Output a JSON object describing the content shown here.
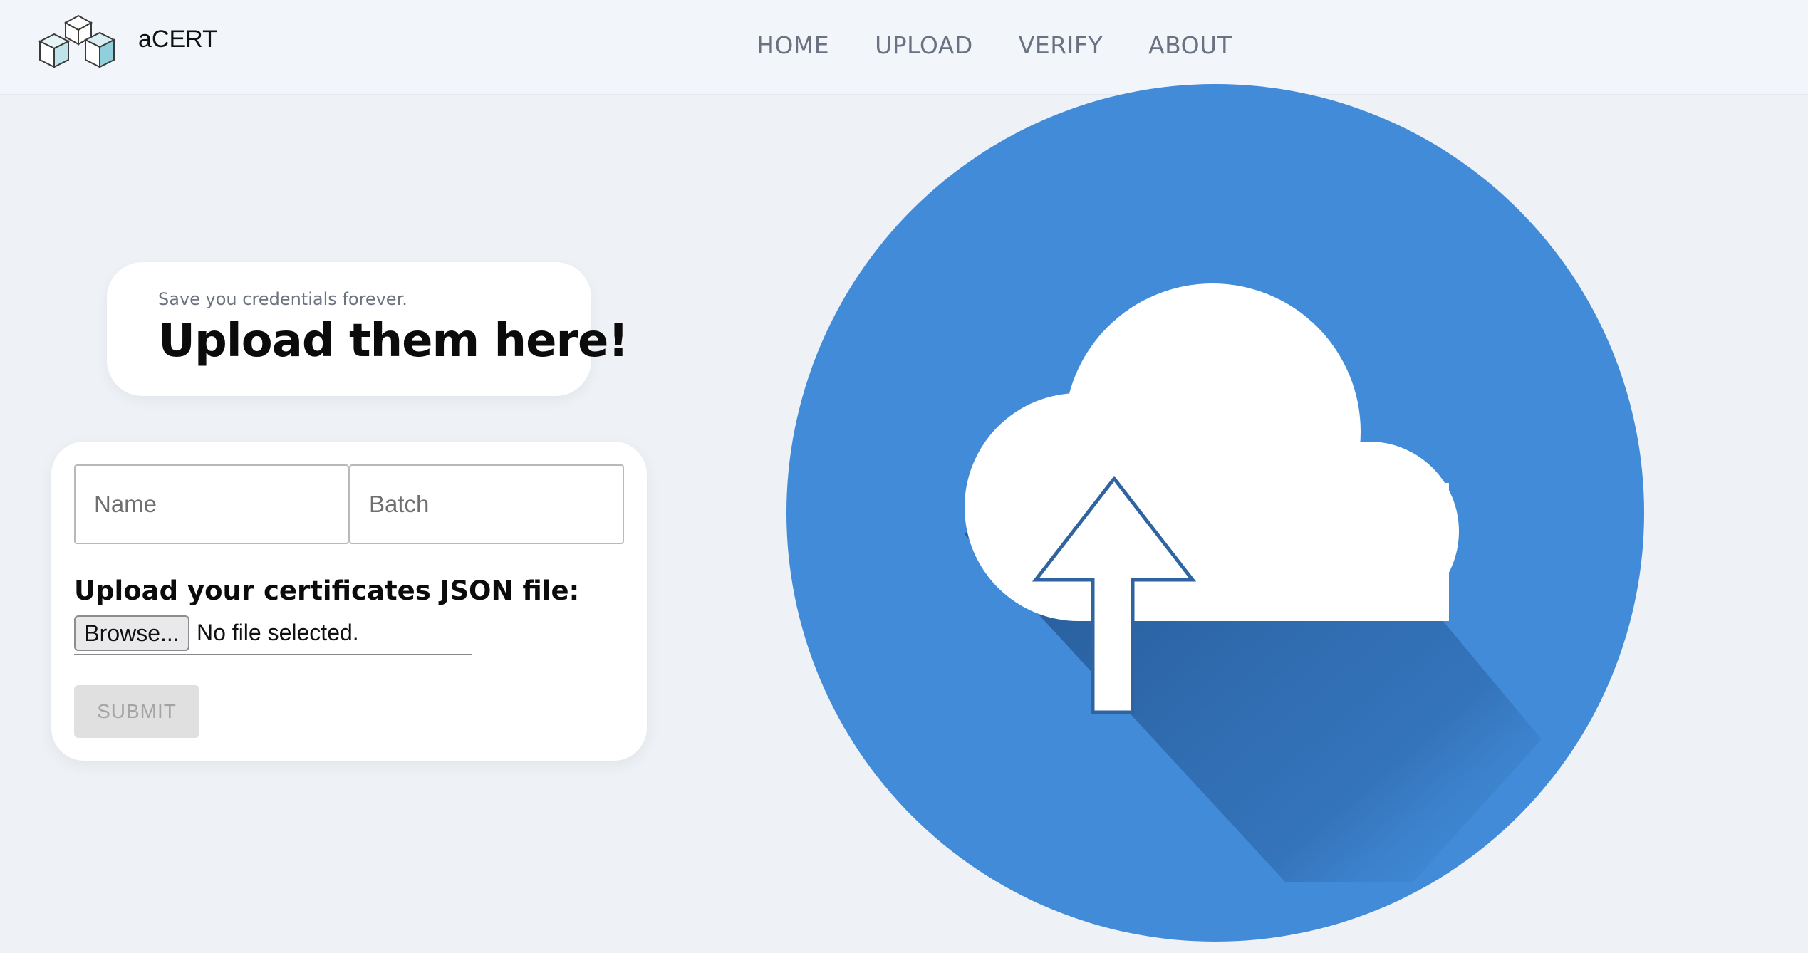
{
  "header": {
    "brand": "aCERT",
    "logo_icon": "cubes-logo-icon",
    "nav": [
      {
        "label": "HOME"
      },
      {
        "label": "UPLOAD"
      },
      {
        "label": "VERIFY"
      },
      {
        "label": "ABOUT"
      }
    ]
  },
  "hero": {
    "subtitle": "Save you credentials forever.",
    "title": "Upload them here!"
  },
  "form": {
    "name_placeholder": "Name",
    "batch_placeholder": "Batch",
    "upload_label": "Upload your certificates JSON file:",
    "browse_label": "Browse...",
    "file_status": "No file selected.",
    "submit_label": "SUBMIT",
    "submit_disabled": true
  },
  "illustration": {
    "icon": "cloud-upload-icon",
    "colors": {
      "circle": "#418bd8",
      "shadow": "#1f4f86",
      "cloud": "#ffffff",
      "arrow_outline": "#2f64a0"
    }
  },
  "colors": {
    "background": "#eef1f6",
    "nav_text": "#6a7282",
    "card": "#ffffff"
  }
}
